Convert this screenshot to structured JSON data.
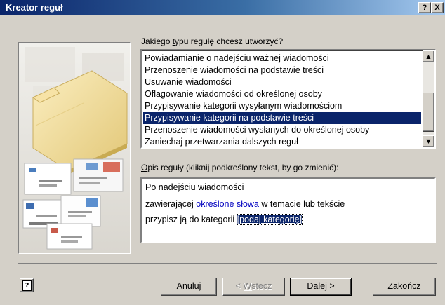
{
  "window": {
    "title": "Kreator reguł",
    "help_glyph": "?",
    "close_glyph": "X"
  },
  "rule_type": {
    "label_pre": "Jakiego ",
    "label_key": "t",
    "label_post": "ypu regułę chcesz utworzyć?",
    "items": [
      "Powiadamianie o nadejściu ważnej wiadomości",
      "Przenoszenie wiadomości na podstawie treści",
      "Usuwanie wiadomości",
      "Oflagowanie wiadomości od określonej osoby",
      "Przypisywanie kategorii wysyłanym wiadomościom",
      "Przypisywanie kategorii na podstawie treści",
      "Przenoszenie wiadomości wysłanych do określonej osoby",
      "Zaniechaj przetwarzania dalszych reguł"
    ],
    "selected_index": 5
  },
  "description": {
    "label_key": "O",
    "label_post": "pis reguły (kliknij podkreślony tekst, by go zmienić):",
    "line1": "Po nadejściu wiadomości",
    "line2_pre": "zawierającej ",
    "line2_link": "określone słowa",
    "line2_post": " w temacie lub tekście",
    "line3_pre": "przypisz ją do kategorii ",
    "line3_link": "[podaj kategorię]"
  },
  "buttons": {
    "help_glyph": "?",
    "cancel": "Anuluj",
    "back_pre": "< ",
    "back_key": "W",
    "back_post": "stecz",
    "next_key": "D",
    "next_post": "alej >",
    "finish": "Zakończ"
  }
}
